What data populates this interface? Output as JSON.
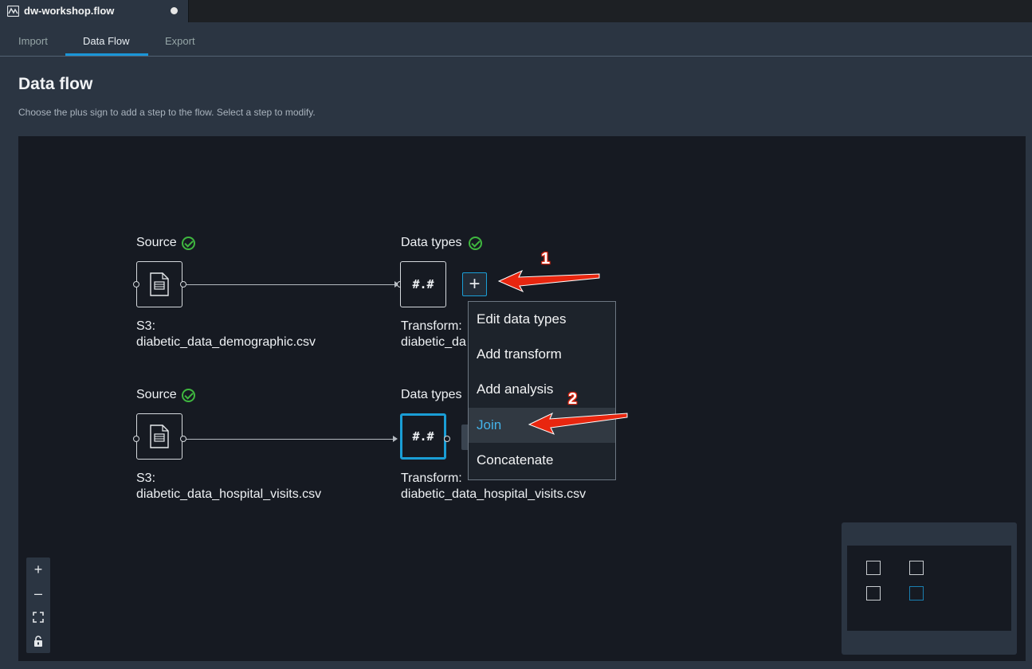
{
  "file_tab": {
    "name": "dw-workshop.flow"
  },
  "tabs": [
    {
      "label": "Import"
    },
    {
      "label": "Data Flow"
    },
    {
      "label": "Export"
    }
  ],
  "page": {
    "title": "Data flow",
    "description": "Choose the plus sign to add a step to the flow. Select a step to modify."
  },
  "flow": {
    "row1": {
      "source_heading": "Source",
      "source_caption_1": "S3:",
      "source_caption_2": "diabetic_data_demographic.csv",
      "dt_heading": "Data types",
      "dt_symbol": "#.#",
      "dt_caption_1": "Transform:",
      "dt_caption_2": "diabetic_da"
    },
    "row2": {
      "source_heading": "Source",
      "source_caption_1": "S3:",
      "source_caption_2": "diabetic_data_hospital_visits.csv",
      "dt_heading": "Data types",
      "dt_symbol": "#.#",
      "dt_caption_1": "Transform:",
      "dt_caption_2": "diabetic_data_hospital_visits.csv"
    },
    "add_step_label": "+"
  },
  "menu": {
    "items": [
      {
        "label": "Edit data types"
      },
      {
        "label": "Add transform"
      },
      {
        "label": "Add analysis"
      },
      {
        "label": "Join"
      },
      {
        "label": "Concatenate"
      }
    ],
    "active": "Join"
  },
  "zoom": {
    "in": "+",
    "out": "–"
  },
  "annotations": {
    "step1": "1",
    "step2": "2"
  },
  "colors": {
    "accent": "#1a9ed6",
    "status_ok": "#3fb73f",
    "annotation": "#e0230d"
  }
}
